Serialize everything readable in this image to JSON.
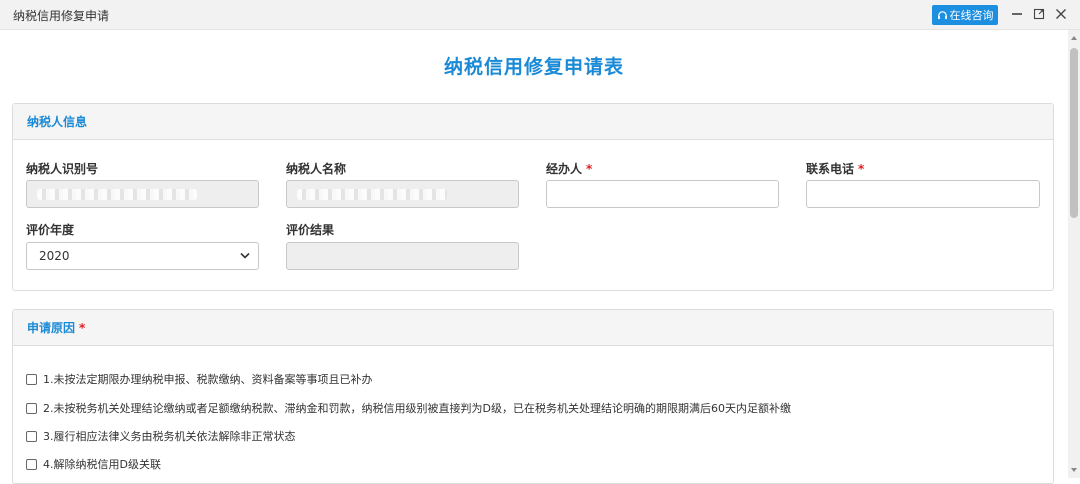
{
  "window": {
    "title": "纳税信用修复申请",
    "consult_label": "在线咨询"
  },
  "form": {
    "title": "纳税信用修复申请表"
  },
  "taxpayer_panel": {
    "heading": "纳税人信息",
    "fields": {
      "tax_id": {
        "label": "纳税人识别号"
      },
      "taxpayer_name": {
        "label": "纳税人名称"
      },
      "handler": {
        "label": "经办人",
        "required_mark": "*",
        "value": ""
      },
      "phone": {
        "label": "联系电话",
        "required_mark": "*",
        "value": ""
      },
      "eval_year": {
        "label": "评价年度",
        "value": "2020"
      },
      "eval_result": {
        "label": "评价结果",
        "value": ""
      }
    }
  },
  "reason_panel": {
    "heading": "申请原因",
    "required_mark": "*",
    "options": [
      {
        "label": "1.未按法定期限办理纳税申报、税款缴纳、资料备案等事项且已补办",
        "checked": false
      },
      {
        "label": "2.未按税务机关处理结论缴纳或者足额缴纳税款、滞纳金和罚款，纳税信用级别被直接判为D级，已在税务机关处理结论明确的期限期满后60天内足额补缴",
        "checked": false
      },
      {
        "label": "3.履行相应法律义务由税务机关依法解除非正常状态",
        "checked": false
      },
      {
        "label": "4.解除纳税信用D级关联",
        "checked": false
      }
    ]
  },
  "colors": {
    "accent": "#1b8ad6",
    "required": "#e02020",
    "consult_button": "#1d8fe0"
  }
}
